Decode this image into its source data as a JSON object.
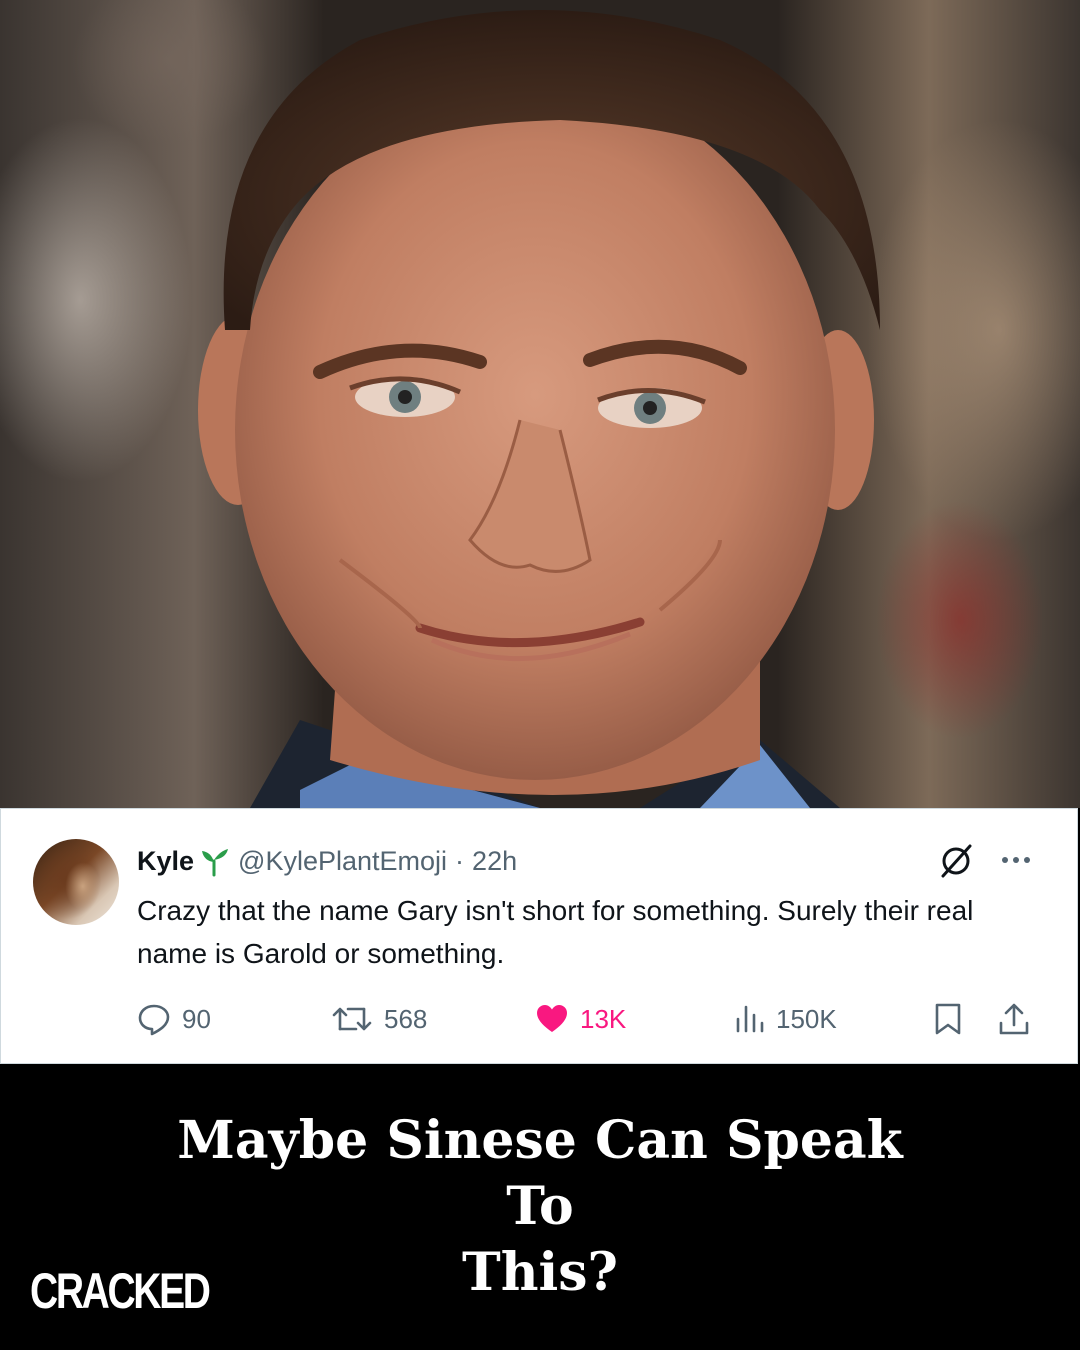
{
  "tweet": {
    "name": "Kyle",
    "handle": "@KylePlantEmoji",
    "separator": "·",
    "time": "22h",
    "text": "Crazy that the name Gary isn't short for something. Surely their real name is Garold or something.",
    "actions": {
      "replies": "90",
      "retweets": "568",
      "likes": "13K",
      "views": "150K"
    },
    "icons": [
      "sprout-icon",
      "grok-icon",
      "more-icon",
      "reply-icon",
      "retweet-icon",
      "heart-icon",
      "views-icon",
      "bookmark-icon",
      "share-icon"
    ],
    "colors": {
      "like": "#f91880",
      "sprout": "#2a9d4a",
      "muted": "#536471",
      "text": "#0f1419"
    }
  },
  "caption": {
    "line1": "Maybe Sinese Can Speak To",
    "line2": "This?"
  },
  "brand": {
    "logo_text": "CRACKED"
  }
}
